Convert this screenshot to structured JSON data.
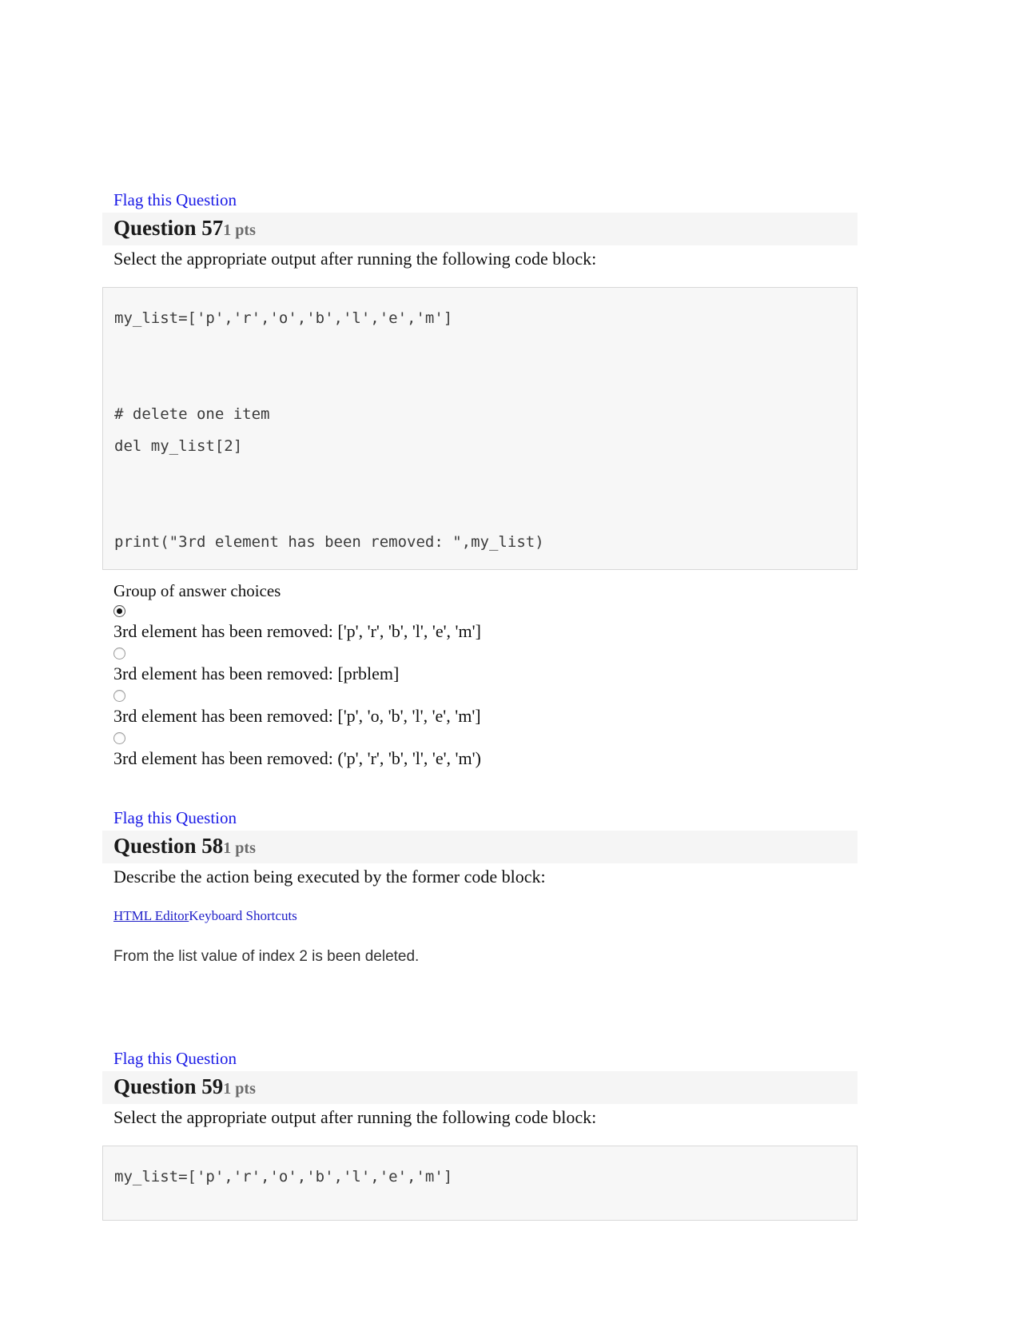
{
  "accent": {
    "link_blue": "#1a1ae6",
    "editor_link_blue": "#2020c8",
    "header_bg": "#f5f5f5",
    "code_bg": "#f7f7f7",
    "code_border": "#d8d8d8",
    "points_gray": "#6b6b6b"
  },
  "questions": [
    {
      "flag_label": "Flag this Question",
      "title": "Question 57",
      "points": "1 pts",
      "prompt": "Select the appropriate output after running the following code block:",
      "code": "my_list=['p','r','o','b','l','e','m']\n\n\n# delete one item\ndel my_list[2]\n\n\nprint(\"3rd element has been removed: \",my_list)",
      "answers_label": "Group of answer choices",
      "answers": [
        {
          "text": "3rd element has been removed: ['p', 'r', 'b', 'l', 'e', 'm']",
          "selected": true
        },
        {
          "text": "3rd element has been removed: [prblem]",
          "selected": false
        },
        {
          "text": "3rd element has been removed: ['p', 'o, 'b', 'l', 'e', 'm']",
          "selected": false
        },
        {
          "text": "3rd element has been removed: ('p', 'r', 'b', 'l', 'e', 'm')",
          "selected": false
        }
      ]
    },
    {
      "flag_label": "Flag this Question",
      "title": "Question 58",
      "points": "1 pts",
      "prompt": "Describe the action being executed by the former code block:",
      "editor_link": "HTML Editor",
      "keyboard_shortcuts": "Keyboard Shortcuts",
      "essay_answer": "From the list value of index 2 is been deleted."
    },
    {
      "flag_label": "Flag this Question",
      "title": "Question 59",
      "points": "1 pts",
      "prompt": "Select the appropriate output after running the following code block:",
      "code": "my_list=['p','r','o','b','l','e','m']"
    }
  ]
}
